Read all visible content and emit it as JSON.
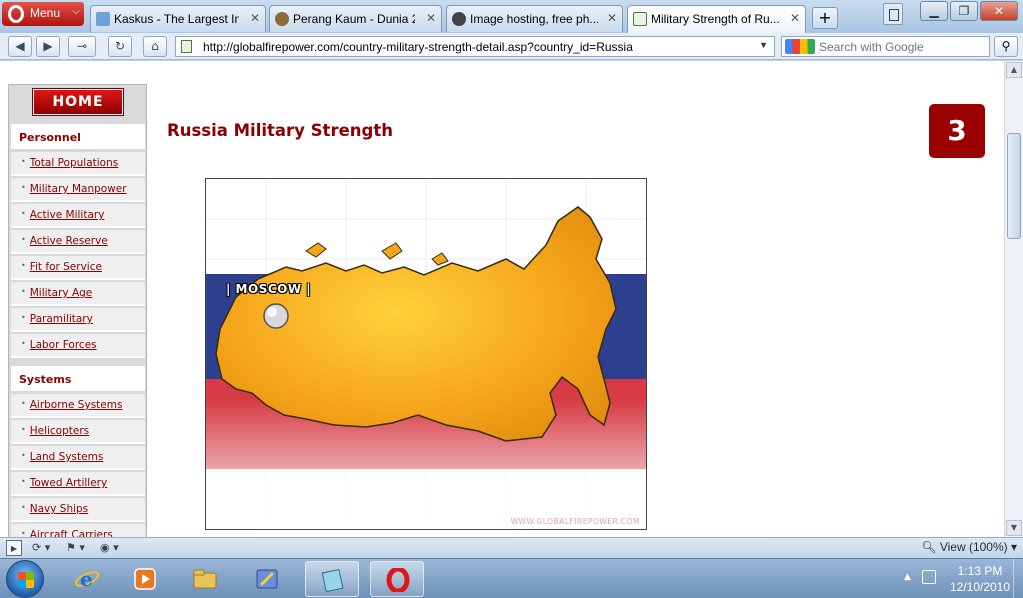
{
  "browser": {
    "menu_label": "Menu",
    "tabs": [
      {
        "label": "Kaskus - The Largest In...",
        "active": false
      },
      {
        "label": "Perang Kaum - Dunia 2",
        "active": false
      },
      {
        "label": "Image hosting, free ph...",
        "active": false
      },
      {
        "label": "Military Strength of Ru...",
        "active": true
      }
    ],
    "address": "http://globalfirepower.com/country-military-strength-detail.asp?country_id=Russia",
    "search_placeholder": "Search with Google",
    "zoom_label": "View (100%)"
  },
  "page": {
    "home_label": "HOME",
    "sections": [
      {
        "title": "Personnel",
        "items": [
          "Total Populations",
          "Military Manpower",
          "Active Military",
          "Active Reserve",
          "Fit for Service",
          "Military Age",
          "Paramilitary",
          "Labor Forces"
        ]
      },
      {
        "title": "Systems",
        "items": [
          "Airborne Systems",
          "Helicopters",
          "Land Systems",
          "Towed Artillery",
          "Navy Ships",
          "Aircraft Carriers"
        ]
      }
    ],
    "title": "Russia Military Strength",
    "rank": "3",
    "map": {
      "city_label": "| MOSCOW |",
      "watermark": "WWW.GLOBALFIREPOWER.COM"
    }
  },
  "taskbar": {
    "time": "1:13 PM",
    "date": "12/10/2010"
  },
  "colors": {
    "brand_red": "#8b0000",
    "badge_red": "#9a0000",
    "flag_white": "#ffffff",
    "flag_blue": "#2d3f8f",
    "flag_red": "#d63b45",
    "map_orange": "#f5a51a"
  }
}
